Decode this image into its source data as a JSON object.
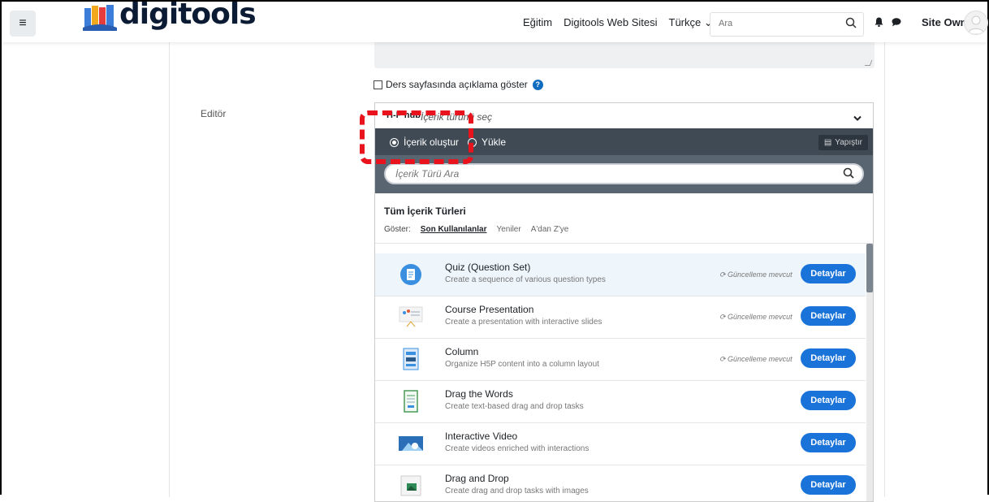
{
  "navbar": {
    "brand": "digitools",
    "links": [
      "Eğitim",
      "Digitools Web Sitesi",
      "Türkçe ⌄"
    ],
    "search_placeholder": "Ara",
    "user": "Site Owner"
  },
  "form": {
    "show_description_label": "Ders sayfasında açıklama göster",
    "editor_label": "Editör"
  },
  "hub": {
    "logo": "H-P hub",
    "title": "İçerik türünü seç",
    "tab_create": "İçerik oluştur",
    "tab_upload": "Yükle",
    "paste_label": "Yapıştır",
    "search_placeholder": "İçerik Türü Ara",
    "types_title": "Tüm İçerik Türleri",
    "show_label": "Göster:",
    "filter_recent": "Son Kullanılanlar",
    "filter_new": "Yeniler",
    "filter_az": "A'dan Z'ye",
    "items": [
      {
        "title": "Quiz (Question Set)",
        "desc": "Create a sequence of various question types",
        "update": "Güncelleme mevcut",
        "button": "Detaylar",
        "icon": "quiz-icon"
      },
      {
        "title": "Course Presentation",
        "desc": "Create a presentation with interactive slides",
        "update": "Güncelleme mevcut",
        "button": "Detaylar",
        "icon": "presentation-icon"
      },
      {
        "title": "Column",
        "desc": "Organize H5P content into a column layout",
        "update": "Güncelleme mevcut",
        "button": "Detaylar",
        "icon": "column-icon"
      },
      {
        "title": "Drag the Words",
        "desc": "Create text-based drag and drop tasks",
        "update": "",
        "button": "Detaylar",
        "icon": "drag-words-icon"
      },
      {
        "title": "Interactive Video",
        "desc": "Create videos enriched with interactions",
        "update": "",
        "button": "Detaylar",
        "icon": "video-icon"
      },
      {
        "title": "Drag and Drop",
        "desc": "Create drag and drop tasks with images",
        "update": "",
        "button": "Detaylar",
        "icon": "drag-drop-icon"
      }
    ]
  },
  "colors": {
    "accent": "#1a73d9",
    "hub_bar": "#404a55",
    "annotation": "#e8131d"
  }
}
